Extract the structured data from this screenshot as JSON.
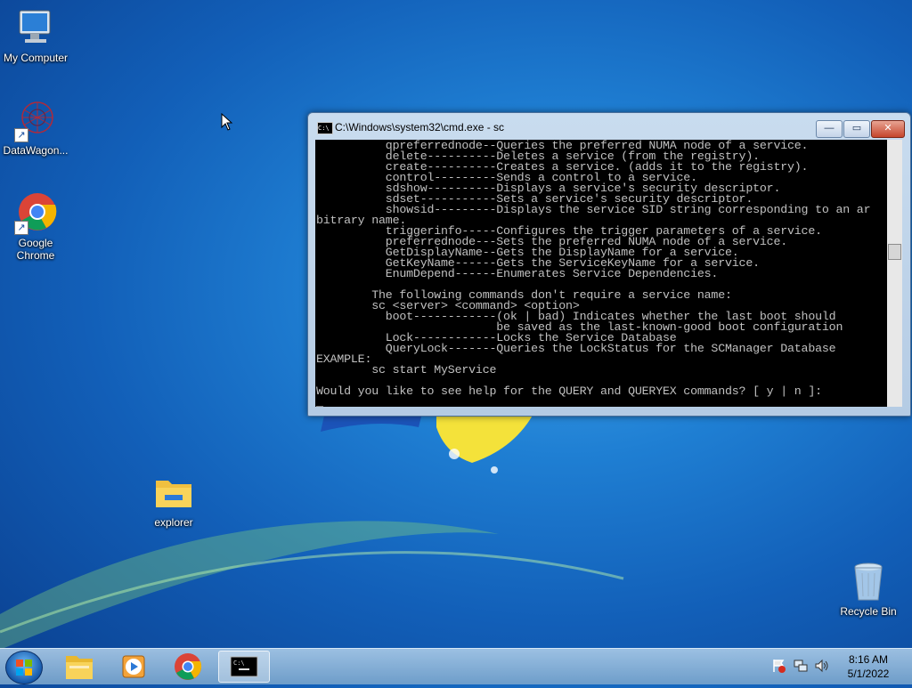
{
  "desktop": {
    "icons": [
      {
        "label": "My Computer",
        "icon": "computer-icon"
      },
      {
        "label": "DataWagon...",
        "icon": "datawagon-icon"
      },
      {
        "label": "Google Chrome",
        "icon": "chrome-icon"
      },
      {
        "label": "explorer",
        "icon": "folder-icon"
      },
      {
        "label": "Recycle Bin",
        "icon": "recycle-bin-icon"
      }
    ]
  },
  "cmd": {
    "title": "C:\\Windows\\system32\\cmd.exe - sc",
    "titlebar_icon_text": "C:\\",
    "minimize": "—",
    "maximize": "▭",
    "close": "✕",
    "output": "          qpreferrednode--Queries the preferred NUMA node of a service.\n          delete----------Deletes a service (from the registry).\n          create----------Creates a service. (adds it to the registry).\n          control---------Sends a control to a service.\n          sdshow----------Displays a service's security descriptor.\n          sdset-----------Sets a service's security descriptor.\n          showsid---------Displays the service SID string corresponding to an ar\nbitrary name.\n          triggerinfo-----Configures the trigger parameters of a service.\n          preferrednode---Sets the preferred NUMA node of a service.\n          GetDisplayName--Gets the DisplayName for a service.\n          GetKeyName------Gets the ServiceKeyName for a service.\n          EnumDepend------Enumerates Service Dependencies.\n\n        The following commands don't require a service name:\n        sc <server> <command> <option>\n          boot------------(ok | bad) Indicates whether the last boot should\n                          be saved as the last-known-good boot configuration\n          Lock------------Locks the Service Database\n          QueryLock-------Queries the LockStatus for the SCManager Database\nEXAMPLE:\n        sc start MyService\n\nWould you like to see help for the QUERY and QUERYEX commands? [ y | n ]:\n_"
  },
  "taskbar": {
    "items": [
      {
        "name": "file-explorer",
        "icon": "folder-icon"
      },
      {
        "name": "media-player",
        "icon": "media-player-icon"
      },
      {
        "name": "chrome",
        "icon": "chrome-icon"
      },
      {
        "name": "cmd",
        "icon": "terminal-icon",
        "active": true
      }
    ],
    "clock_time": "8:16 AM",
    "clock_date": "5/1/2022"
  },
  "colors": {
    "desktop_bg": "#1f7fd3",
    "console_bg": "#000000",
    "console_fg": "#c0c0c0"
  }
}
